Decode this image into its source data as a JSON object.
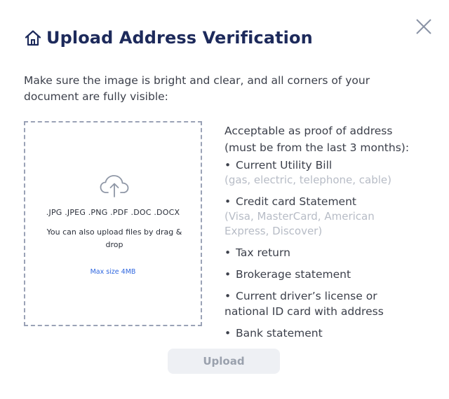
{
  "modal": {
    "title": "Upload Address Verification",
    "intro": "Make sure the image is bright and clear, and all corners of your document are fully visible:",
    "icons": {
      "title": "home-icon",
      "close": "close-icon",
      "upload": "cloud-upload-icon"
    }
  },
  "dropzone": {
    "formats": ".JPG .JPEG .PNG .PDF .DOC .DOCX",
    "drag_drop": "You can also upload files by drag & drop",
    "max_size": "Max size 4MB"
  },
  "proof_info": {
    "lead": "Acceptable as proof of address (must be from the last 3 months):",
    "items": [
      {
        "label": "Current Utility Bill",
        "note": "(gas, electric, telephone, cable)"
      },
      {
        "label": "Credit card Statement",
        "note": "(Visa, MasterCard, American Express, Discover)"
      },
      {
        "label": "Tax return"
      },
      {
        "label": "Brokerage statement"
      },
      {
        "label": "Current driver’s license or national ID card with address"
      },
      {
        "label": "Bank statement"
      }
    ]
  },
  "actions": {
    "upload_label": "Upload",
    "upload_enabled": false
  },
  "colors": {
    "title": "#1d2a5b",
    "link": "#2f67e0",
    "muted": "#b7bcc6",
    "button_bg": "#eef0f4"
  }
}
